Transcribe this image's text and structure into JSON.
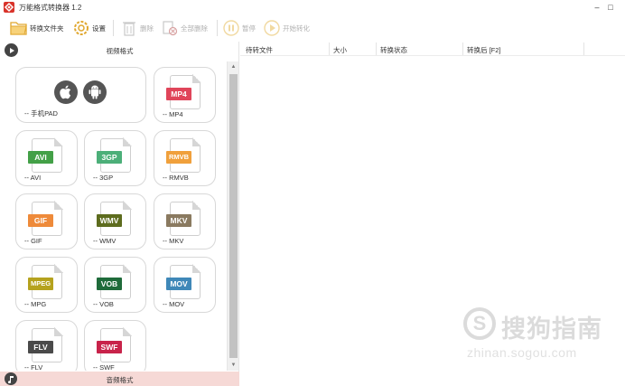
{
  "window": {
    "title": "万能格式转换器 1.2",
    "minimize_glyph": "–",
    "maximize_glyph": "□"
  },
  "toolbar": {
    "convert_folder": {
      "label": "转换文件夹",
      "icon": "folder-icon"
    },
    "settings": {
      "label": "设置",
      "icon": "gear-icon"
    },
    "delete": {
      "label": "删除",
      "icon": "trash-icon"
    },
    "delete_all": {
      "label": "全部删除",
      "icon": "delete-all-icon"
    },
    "pause": {
      "label": "暂停",
      "icon": "pause-icon"
    },
    "start": {
      "label": "开始转化",
      "icon": "play-icon"
    }
  },
  "left_panel": {
    "video_section_title": "视频格式",
    "audio_section_title": "音频格式",
    "formats": [
      {
        "tag": "",
        "label": "-- 手机PAD",
        "color": "#555555"
      },
      {
        "tag": "MP4",
        "label": "-- MP4",
        "color": "#e0455a"
      },
      {
        "tag": "AVI",
        "label": "-- AVI",
        "color": "#43a047"
      },
      {
        "tag": "3GP",
        "label": "-- 3GP",
        "color": "#4caf79"
      },
      {
        "tag": "RMVB",
        "label": "-- RMVB",
        "color": "#f0a03c"
      },
      {
        "tag": "GIF",
        "label": "-- GIF",
        "color": "#ee8a3a"
      },
      {
        "tag": "WMV",
        "label": "-- WMV",
        "color": "#5d6c1e"
      },
      {
        "tag": "MKV",
        "label": "-- MKV",
        "color": "#8a7a60"
      },
      {
        "tag": "MPEG",
        "label": "-- MPG",
        "color": "#b5a21e"
      },
      {
        "tag": "VOB",
        "label": "-- VOB",
        "color": "#1f6b3a"
      },
      {
        "tag": "MOV",
        "label": "-- MOV",
        "color": "#3f88b8"
      },
      {
        "tag": "FLV",
        "label": "-- FLV",
        "color": "#4a4a4a"
      },
      {
        "tag": "SWF",
        "label": "-- SWF",
        "color": "#c8234a"
      }
    ]
  },
  "table": {
    "columns": [
      "待转文件",
      "大小",
      "转换状态",
      "转换后 [F2]"
    ]
  },
  "watermark": {
    "text": "搜狗指南",
    "url": "zhinan.sogou.com",
    "logo_letter": "S"
  },
  "colors": {
    "accent_red": "#d9342b",
    "folder_yellow": "#f2c14e",
    "audio_bar": "#f6d9d6"
  }
}
